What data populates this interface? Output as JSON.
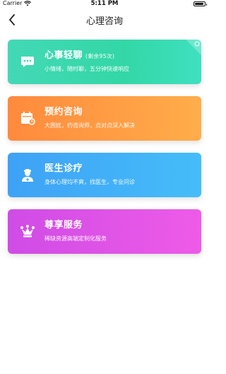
{
  "status_bar": {
    "carrier": "Carrier",
    "time": "5:11 PM",
    "battery_level": 0.9
  },
  "nav": {
    "title": "心理咨询",
    "back_icon": "chevron-left-icon"
  },
  "cards": [
    {
      "title": "心事轻聊",
      "note": "(剩余95次)",
      "subtitle": "小情绪，随时聊，五分钟快速响应",
      "icon": "chat-bubble-icon",
      "color": "#3ddbb0"
    },
    {
      "title": "预约咨询",
      "note": "",
      "subtitle": "大困扰，约咨询师，点对点深入解决",
      "icon": "calendar-icon",
      "color": "#ff9a42"
    },
    {
      "title": "医生诊疗",
      "note": "",
      "subtitle": "身体心理均不爽，找医生，专业问诊",
      "icon": "doctor-icon",
      "color": "#42aff8"
    },
    {
      "title": "尊享服务",
      "note": "",
      "subtitle": "稀缺资源高端定制化服务",
      "icon": "crown-icon",
      "color": "#e054e7"
    }
  ]
}
